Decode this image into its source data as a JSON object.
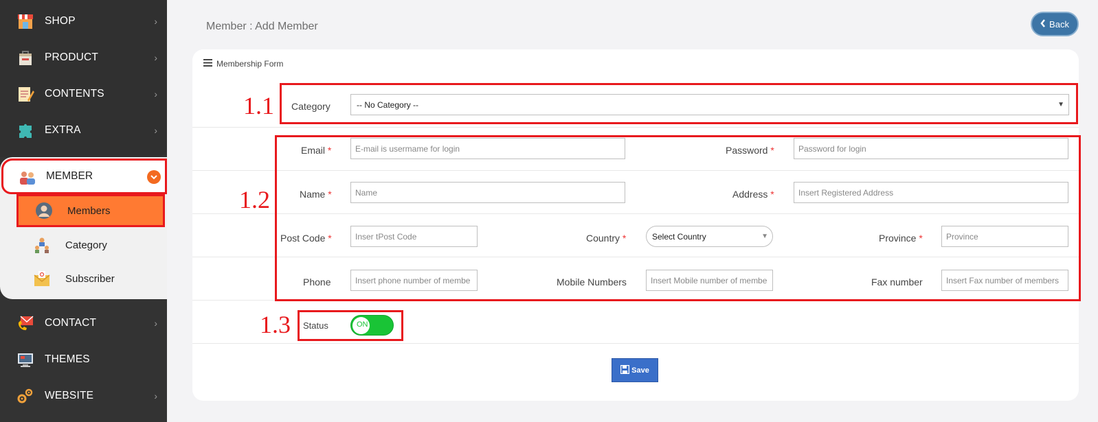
{
  "sidebar": {
    "items_top": [
      {
        "label": "SHOP",
        "icon": "shop-icon"
      },
      {
        "label": "PRODUCT",
        "icon": "product-icon"
      },
      {
        "label": "CONTENTS",
        "icon": "contents-icon"
      },
      {
        "label": "EXTRA",
        "icon": "extra-icon"
      }
    ],
    "member": {
      "label": "MEMBER",
      "icon": "member-icon"
    },
    "submenu": [
      {
        "label": "Members",
        "icon": "user-icon",
        "active": true
      },
      {
        "label": "Category",
        "icon": "category-icon"
      },
      {
        "label": "Subscriber",
        "icon": "subscriber-icon"
      }
    ],
    "items_bottom": [
      {
        "label": "CONTACT",
        "icon": "contact-icon"
      },
      {
        "label": "THEMES",
        "icon": "themes-icon"
      },
      {
        "label": "WEBSITE",
        "icon": "website-icon"
      }
    ]
  },
  "header": {
    "title": "Member : Add Member",
    "back_label": "Back"
  },
  "form": {
    "title": "Membership Form",
    "category": {
      "label": "Category",
      "value": "-- No Category --"
    },
    "email": {
      "label": "Email",
      "placeholder": "E-mail is usermame for login"
    },
    "password": {
      "label": "Password",
      "placeholder": "Password for login"
    },
    "name": {
      "label": "Name",
      "placeholder": "Name"
    },
    "address": {
      "label": "Address",
      "placeholder": "Insert Registered Address"
    },
    "postcode": {
      "label": "Post Code",
      "placeholder": "Inser tPost Code"
    },
    "country": {
      "label": "Country",
      "value": "Select Country"
    },
    "province": {
      "label": "Province",
      "placeholder": "Province"
    },
    "phone": {
      "label": "Phone",
      "placeholder": "Insert phone number of membe"
    },
    "mobile": {
      "label": "Mobile Numbers",
      "placeholder": "Insert Mobile number of membe"
    },
    "fax": {
      "label": "Fax number",
      "placeholder": "Insert Fax number of members"
    },
    "status": {
      "label": "Status",
      "toggle_text": "ON",
      "on": true
    },
    "required_mark": "*",
    "save_label": "Save"
  },
  "annotations": {
    "a1": "1.1",
    "a2": "1.2",
    "a3": "1.3"
  },
  "colors": {
    "accent": "#ff7a32",
    "highlight": "#e8191d",
    "toggle_on": "#19c436",
    "save": "#3a6fc9",
    "back": "#3d75a6"
  }
}
